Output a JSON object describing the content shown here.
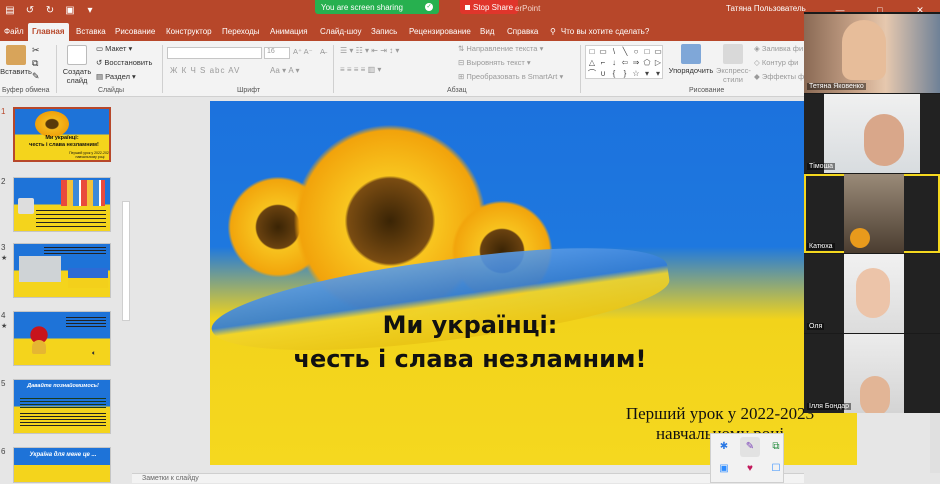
{
  "titlebar": {
    "quick_access": [
      "▤",
      "↺",
      "↻",
      "▣",
      "▾"
    ],
    "sharing_text": "You are screen sharing",
    "stop_share_label": "Stop Share",
    "app_title_fragment": "erPoint",
    "user_name": "Татяна Пользователь",
    "window_controls": [
      "—",
      "□",
      "✕"
    ]
  },
  "tabs": [
    "Файл",
    "Главная",
    "Вставка",
    "Рисование",
    "Конструктор",
    "Переходы",
    "Анимация",
    "Слайд-шоу",
    "Запись",
    "Рецензирование",
    "Вид",
    "Справка"
  ],
  "tell_me": "Что вы хотите сделать?",
  "ribbon": {
    "paste": "Вставить",
    "clipboard_group": "Буфер обмена",
    "new_slide_1": "Создать",
    "new_slide_2": "слайд",
    "layout": "Макет",
    "reset": "Восстановить",
    "section": "Раздел",
    "slides_group": "Слайды",
    "font_size": "16",
    "font_group": "Шрифт",
    "font_buttons": "Ж  К  Ч  S  abc  AV",
    "paragraph_group": "Абзац",
    "text_direction": "Направление текста",
    "align_text": "Выровнять текст",
    "smartart": "Преобразовать в SmartArt",
    "arrange": "Упорядочить",
    "quick_styles_1": "Экспресс-",
    "quick_styles_2": "стили",
    "drawing_group": "Рисование",
    "shape_fill": "Заливка фи",
    "shape_outline": "Контур фи",
    "shape_effects": "Эффекты ф",
    "shapes": [
      "□",
      "▭",
      "\\",
      "╲",
      "○",
      "□",
      "▭",
      "△",
      "⌐",
      "↓",
      "⇦",
      "⇒",
      "⬠",
      "▷",
      "⌒",
      "∪",
      "{",
      "}",
      "☆",
      "▾",
      "▾"
    ]
  },
  "slides": [
    {
      "num": "1",
      "star": ""
    },
    {
      "num": "2",
      "star": ""
    },
    {
      "num": "3",
      "star": "★"
    },
    {
      "num": "4",
      "star": "★"
    },
    {
      "num": "5",
      "star": ""
    },
    {
      "num": "6",
      "star": ""
    }
  ],
  "thumbs": {
    "t1_title": "Ми українці:",
    "t1_sub": "честь і слава незламним!",
    "t1_small": "Перший урок у 2022-2023 навчальному році",
    "t5_title": "Давайте познайомимось!",
    "t6_title": "Україна для мене це ..."
  },
  "slide": {
    "title_line1": "Ми українці:",
    "title_line2": "честь і слава незламним!",
    "subtitle_line1": "Перший урок у 2022-2023",
    "subtitle_line2": "навчальному році"
  },
  "notes_placeholder": "Заметки к слайду",
  "participants": [
    {
      "name": "Тетяна Яковенко"
    },
    {
      "name": "Тімоша"
    },
    {
      "name": "Катюха"
    },
    {
      "name": "Оля"
    },
    {
      "name": "Ілля Бондар"
    }
  ],
  "zoom_toolbar": [
    "✱",
    "✎",
    "⧉",
    "▣",
    "♥",
    "☐"
  ],
  "colors": {
    "accent": "#b7472a",
    "ua_blue": "#1e78df",
    "ua_yellow": "#f5d81f",
    "share_green": "#27b04f",
    "stop_red": "#e0352b"
  }
}
